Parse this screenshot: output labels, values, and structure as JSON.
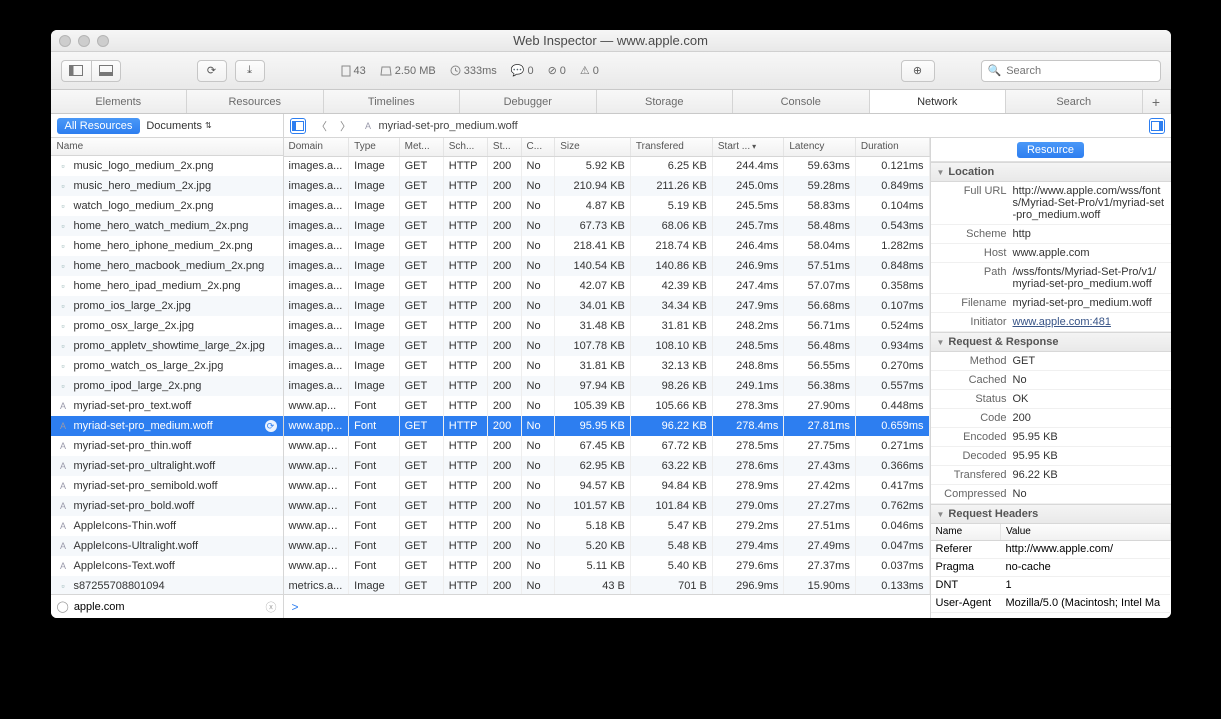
{
  "window_title": "Web Inspector — www.apple.com",
  "toolbar_stats": {
    "doc_count": "43",
    "size": "2.50 MB",
    "time": "333ms",
    "logs": "0",
    "errors": "0",
    "warnings": "0"
  },
  "search_placeholder": "Search",
  "tabs": [
    "Elements",
    "Resources",
    "Timelines",
    "Debugger",
    "Storage",
    "Console",
    "Network",
    "Search"
  ],
  "active_tab": 6,
  "filter_pill": "All Resources",
  "scope_dropdown": "Documents",
  "breadcrumb_file": "myriad-set-pro_medium.woff",
  "left_header": "Name",
  "filter_value": "apple.com",
  "console_prompt": ">",
  "resource_pill": "Resource",
  "columns": [
    "Domain",
    "Type",
    "Met...",
    "Sch...",
    "St...",
    "C...",
    "Size",
    "Transfered",
    "Start ...",
    "Latency",
    "Duration"
  ],
  "sorted_col": 8,
  "selected_index": 10,
  "rows": [
    {
      "name": "music_logo_medium_2x.png",
      "icon": "img",
      "domain": "images.a...",
      "type": "Image",
      "method": "GET",
      "scheme": "HTTP",
      "status": "200",
      "cached": "No",
      "size": "5.92 KB",
      "transfered": "6.25 KB",
      "start": "244.4ms",
      "latency": "59.63ms",
      "duration": "0.121ms"
    },
    {
      "name": "music_hero_medium_2x.jpg",
      "icon": "img",
      "domain": "images.a...",
      "type": "Image",
      "method": "GET",
      "scheme": "HTTP",
      "status": "200",
      "cached": "No",
      "size": "210.94 KB",
      "transfered": "211.26 KB",
      "start": "245.0ms",
      "latency": "59.28ms",
      "duration": "0.849ms"
    },
    {
      "name": "watch_logo_medium_2x.png",
      "icon": "img",
      "domain": "images.a...",
      "type": "Image",
      "method": "GET",
      "scheme": "HTTP",
      "status": "200",
      "cached": "No",
      "size": "4.87 KB",
      "transfered": "5.19 KB",
      "start": "245.5ms",
      "latency": "58.83ms",
      "duration": "0.104ms"
    },
    {
      "name": "home_hero_watch_medium_2x.png",
      "icon": "img",
      "domain": "images.a...",
      "type": "Image",
      "method": "GET",
      "scheme": "HTTP",
      "status": "200",
      "cached": "No",
      "size": "67.73 KB",
      "transfered": "68.06 KB",
      "start": "245.7ms",
      "latency": "58.48ms",
      "duration": "0.543ms"
    },
    {
      "name": "home_hero_iphone_medium_2x.png",
      "icon": "img",
      "domain": "images.a...",
      "type": "Image",
      "method": "GET",
      "scheme": "HTTP",
      "status": "200",
      "cached": "No",
      "size": "218.41 KB",
      "transfered": "218.74 KB",
      "start": "246.4ms",
      "latency": "58.04ms",
      "duration": "1.282ms"
    },
    {
      "name": "home_hero_macbook_medium_2x.png",
      "icon": "img",
      "domain": "images.a...",
      "type": "Image",
      "method": "GET",
      "scheme": "HTTP",
      "status": "200",
      "cached": "No",
      "size": "140.54 KB",
      "transfered": "140.86 KB",
      "start": "246.9ms",
      "latency": "57.51ms",
      "duration": "0.848ms"
    },
    {
      "name": "home_hero_ipad_medium_2x.png",
      "icon": "img",
      "domain": "images.a...",
      "type": "Image",
      "method": "GET",
      "scheme": "HTTP",
      "status": "200",
      "cached": "No",
      "size": "42.07 KB",
      "transfered": "42.39 KB",
      "start": "247.4ms",
      "latency": "57.07ms",
      "duration": "0.358ms"
    },
    {
      "name": "promo_ios_large_2x.jpg",
      "icon": "img",
      "domain": "images.a...",
      "type": "Image",
      "method": "GET",
      "scheme": "HTTP",
      "status": "200",
      "cached": "No",
      "size": "34.01 KB",
      "transfered": "34.34 KB",
      "start": "247.9ms",
      "latency": "56.68ms",
      "duration": "0.107ms"
    },
    {
      "name": "promo_osx_large_2x.jpg",
      "icon": "img",
      "domain": "images.a...",
      "type": "Image",
      "method": "GET",
      "scheme": "HTTP",
      "status": "200",
      "cached": "No",
      "size": "31.48 KB",
      "transfered": "31.81 KB",
      "start": "248.2ms",
      "latency": "56.71ms",
      "duration": "0.524ms"
    },
    {
      "name": "promo_appletv_showtime_large_2x.jpg",
      "icon": "img",
      "domain": "images.a...",
      "type": "Image",
      "method": "GET",
      "scheme": "HTTP",
      "status": "200",
      "cached": "No",
      "size": "107.78 KB",
      "transfered": "108.10 KB",
      "start": "248.5ms",
      "latency": "56.48ms",
      "duration": "0.934ms"
    },
    {
      "name": "promo_watch_os_large_2x.jpg",
      "icon": "img",
      "domain": "images.a...",
      "type": "Image",
      "method": "GET",
      "scheme": "HTTP",
      "status": "200",
      "cached": "No",
      "size": "31.81 KB",
      "transfered": "32.13 KB",
      "start": "248.8ms",
      "latency": "56.55ms",
      "duration": "0.270ms"
    },
    {
      "name": "promo_ipod_large_2x.png",
      "icon": "img",
      "domain": "images.a...",
      "type": "Image",
      "method": "GET",
      "scheme": "HTTP",
      "status": "200",
      "cached": "No",
      "size": "97.94 KB",
      "transfered": "98.26 KB",
      "start": "249.1ms",
      "latency": "56.38ms",
      "duration": "0.557ms"
    },
    {
      "name": "myriad-set-pro_text.woff",
      "icon": "font",
      "domain": "www.ap...",
      "type": "Font",
      "method": "GET",
      "scheme": "HTTP",
      "status": "200",
      "cached": "No",
      "size": "105.39 KB",
      "transfered": "105.66 KB",
      "start": "278.3ms",
      "latency": "27.90ms",
      "duration": "0.448ms"
    },
    {
      "name": "myriad-set-pro_medium.woff",
      "icon": "font",
      "domain": "www.app...",
      "type": "Font",
      "method": "GET",
      "scheme": "HTTP",
      "status": "200",
      "cached": "No",
      "size": "95.95 KB",
      "transfered": "96.22 KB",
      "start": "278.4ms",
      "latency": "27.81ms",
      "duration": "0.659ms"
    },
    {
      "name": "myriad-set-pro_thin.woff",
      "icon": "font",
      "domain": "www.apple...",
      "type": "Font",
      "method": "GET",
      "scheme": "HTTP",
      "status": "200",
      "cached": "No",
      "size": "67.45 KB",
      "transfered": "67.72 KB",
      "start": "278.5ms",
      "latency": "27.75ms",
      "duration": "0.271ms"
    },
    {
      "name": "myriad-set-pro_ultralight.woff",
      "icon": "font",
      "domain": "www.apple...",
      "type": "Font",
      "method": "GET",
      "scheme": "HTTP",
      "status": "200",
      "cached": "No",
      "size": "62.95 KB",
      "transfered": "63.22 KB",
      "start": "278.6ms",
      "latency": "27.43ms",
      "duration": "0.366ms"
    },
    {
      "name": "myriad-set-pro_semibold.woff",
      "icon": "font",
      "domain": "www.apple...",
      "type": "Font",
      "method": "GET",
      "scheme": "HTTP",
      "status": "200",
      "cached": "No",
      "size": "94.57 KB",
      "transfered": "94.84 KB",
      "start": "278.9ms",
      "latency": "27.42ms",
      "duration": "0.417ms"
    },
    {
      "name": "myriad-set-pro_bold.woff",
      "icon": "font",
      "domain": "www.apple...",
      "type": "Font",
      "method": "GET",
      "scheme": "HTTP",
      "status": "200",
      "cached": "No",
      "size": "101.57 KB",
      "transfered": "101.84 KB",
      "start": "279.0ms",
      "latency": "27.27ms",
      "duration": "0.762ms"
    },
    {
      "name": "AppleIcons-Thin.woff",
      "icon": "font",
      "domain": "www.apple...",
      "type": "Font",
      "method": "GET",
      "scheme": "HTTP",
      "status": "200",
      "cached": "No",
      "size": "5.18 KB",
      "transfered": "5.47 KB",
      "start": "279.2ms",
      "latency": "27.51ms",
      "duration": "0.046ms"
    },
    {
      "name": "AppleIcons-Ultralight.woff",
      "icon": "font",
      "domain": "www.apple...",
      "type": "Font",
      "method": "GET",
      "scheme": "HTTP",
      "status": "200",
      "cached": "No",
      "size": "5.20 KB",
      "transfered": "5.48 KB",
      "start": "279.4ms",
      "latency": "27.49ms",
      "duration": "0.047ms"
    },
    {
      "name": "AppleIcons-Text.woff",
      "icon": "font",
      "domain": "www.apple...",
      "type": "Font",
      "method": "GET",
      "scheme": "HTTP",
      "status": "200",
      "cached": "No",
      "size": "5.11 KB",
      "transfered": "5.40 KB",
      "start": "279.6ms",
      "latency": "27.37ms",
      "duration": "0.037ms"
    },
    {
      "name": "s87255708801094",
      "icon": "img",
      "domain": "metrics.a...",
      "type": "Image",
      "method": "GET",
      "scheme": "HTTP",
      "status": "200",
      "cached": "No",
      "size": "43 B",
      "transfered": "701 B",
      "start": "296.9ms",
      "latency": "15.90ms",
      "duration": "0.133ms"
    }
  ],
  "details": {
    "location": {
      "heading": "Location",
      "full_url_label": "Full URL",
      "full_url": "http://www.apple.com/wss/fonts/Myriad-Set-Pro/v1/myriad-set-pro_medium.woff",
      "scheme_label": "Scheme",
      "scheme": "http",
      "host_label": "Host",
      "host": "www.apple.com",
      "path_label": "Path",
      "path": "/wss/fonts/Myriad-Set-Pro/v1/myriad-set-pro_medium.woff",
      "filename_label": "Filename",
      "filename": "myriad-set-pro_medium.woff",
      "initiator_label": "Initiator",
      "initiator": "www.apple.com:481"
    },
    "reqresp": {
      "heading": "Request & Response",
      "method_label": "Method",
      "method": "GET",
      "cached_label": "Cached",
      "cached": "No",
      "status_label": "Status",
      "status": "OK",
      "code_label": "Code",
      "code": "200",
      "encoded_label": "Encoded",
      "encoded": "95.95 KB",
      "decoded_label": "Decoded",
      "decoded": "95.95 KB",
      "transfered_label": "Transfered",
      "transfered": "96.22 KB",
      "compressed_label": "Compressed",
      "compressed": "No"
    },
    "req_headers": {
      "heading": "Request Headers",
      "name_col": "Name",
      "value_col": "Value",
      "rows": [
        {
          "name": "Referer",
          "value": "http://www.apple.com/"
        },
        {
          "name": "Pragma",
          "value": "no-cache"
        },
        {
          "name": "DNT",
          "value": "1"
        },
        {
          "name": "User-Agent",
          "value": "Mozilla/5.0 (Macintosh; Intel Ma"
        }
      ]
    }
  }
}
